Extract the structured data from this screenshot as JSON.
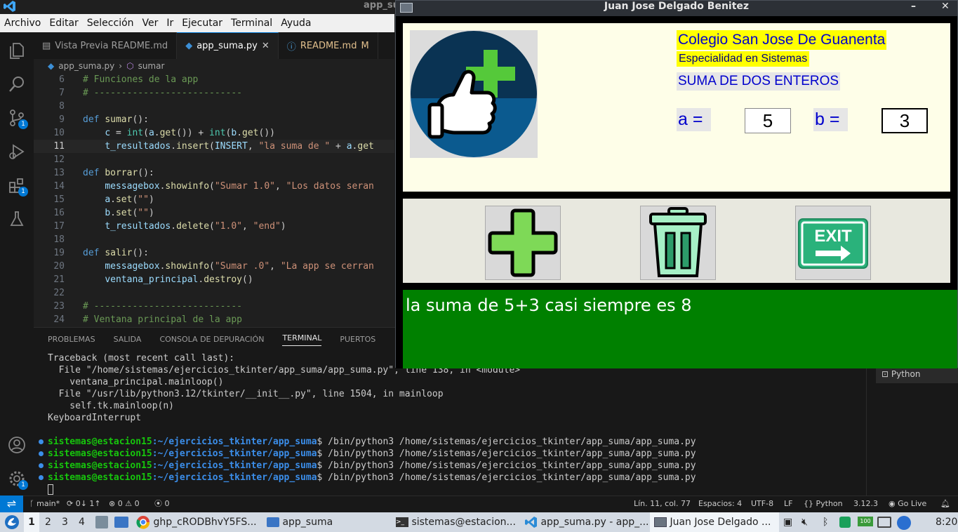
{
  "vscode": {
    "window_title": "app_su",
    "menu": [
      "Archivo",
      "Editar",
      "Selección",
      "Ver",
      "Ir",
      "Ejecutar",
      "Terminal",
      "Ayuda"
    ],
    "tabs": [
      {
        "label": "Vista Previa README.md",
        "active": false
      },
      {
        "label": "app_suma.py",
        "active": true
      },
      {
        "label": "README.md",
        "modified": "M",
        "active": false
      }
    ],
    "breadcrumb": {
      "file": "app_suma.py",
      "symbol": "sumar"
    },
    "badges": {
      "scm": "1",
      "extensions": "1",
      "settings": "1"
    },
    "code": [
      {
        "n": "6",
        "html": "<span class='cm'># Funciones de la app</span>"
      },
      {
        "n": "7",
        "html": "<span class='cm'># ---------------------------</span>"
      },
      {
        "n": "8",
        "html": ""
      },
      {
        "n": "9",
        "html": "<span class='kw'>def</span> <span class='fn'>sumar</span>():"
      },
      {
        "n": "10",
        "html": "    <span class='va'>c</span> = <span class='bi'>int</span>(<span class='va'>a</span>.<span class='fn'>get</span>()) + <span class='bi'>int</span>(<span class='va'>b</span>.<span class='fn'>get</span>())"
      },
      {
        "n": "11",
        "html": "    <span class='va'>t_resultados</span>.<span class='fn'>insert</span>(<span class='va'>INSERT</span>, <span class='st'>\"la suma de \"</span> + <span class='va'>a</span>.<span class='fn'>get</span>",
        "current": true
      },
      {
        "n": "12",
        "html": ""
      },
      {
        "n": "13",
        "html": "<span class='kw'>def</span> <span class='fn'>borrar</span>():"
      },
      {
        "n": "14",
        "html": "    <span class='va'>messagebox</span>.<span class='fn'>showinfo</span>(<span class='st'>\"Sumar 1.0\"</span>, <span class='st'>\"Los datos seran</span>"
      },
      {
        "n": "15",
        "html": "    <span class='va'>a</span>.<span class='fn'>set</span>(<span class='st'>\"\"</span>)"
      },
      {
        "n": "16",
        "html": "    <span class='va'>b</span>.<span class='fn'>set</span>(<span class='st'>\"\"</span>)"
      },
      {
        "n": "17",
        "html": "    <span class='va'>t_resultados</span>.<span class='fn'>delete</span>(<span class='st'>\"1.0\"</span>, <span class='st'>\"end\"</span>)"
      },
      {
        "n": "18",
        "html": ""
      },
      {
        "n": "19",
        "html": "<span class='kw'>def</span> <span class='fn'>salir</span>():"
      },
      {
        "n": "20",
        "html": "    <span class='va'>messagebox</span>.<span class='fn'>showinfo</span>(<span class='st'>\"Sumar .0\"</span>, <span class='st'>\"La app se cerran</span>"
      },
      {
        "n": "21",
        "html": "    <span class='va'>ventana_principal</span>.<span class='fn'>destroy</span>()"
      },
      {
        "n": "22",
        "html": ""
      },
      {
        "n": "23",
        "html": "<span class='cm'># ---------------------------</span>"
      },
      {
        "n": "24",
        "html": "<span class='cm'># Ventana principal de la app</span>"
      }
    ],
    "panel_tabs": [
      "PROBLEMAS",
      "SALIDA",
      "CONSOLA DE DEPURACIÓN",
      "TERMINAL",
      "PUERTOS"
    ],
    "active_panel_tab": "TERMINAL",
    "terminal": {
      "traceback": [
        "Traceback (most recent call last):",
        "  File \"/home/sistemas/ejercicios_tkinter/app_suma/app_suma.py\", line 138, in <module>",
        "    ventana_principal.mainloop()",
        "  File \"/usr/lib/python3.12/tkinter/__init__.py\", line 1504, in mainloop",
        "    self.tk.mainloop(n)",
        "KeyboardInterrupt"
      ],
      "prompt_user": "sistemas@estacion15",
      "prompt_path": ":~/ejercicios_tkinter/app_suma",
      "command": "$ /bin/python3 /home/sistemas/ejercicios_tkinter/app_suma/app_suma.py",
      "command_count": 4,
      "shell_label": "Python"
    },
    "status": {
      "branch": "main*",
      "sync": "0↓ 1↑",
      "problems": "0",
      "warnings": "0",
      "ports": "0",
      "position": "Lín. 11, col. 77",
      "spaces": "Espacios: 4",
      "encoding": "UTF-8",
      "eol": "LF",
      "language": "Python",
      "python_version": "3.12.3",
      "golive": "Go Live"
    }
  },
  "tk": {
    "title": "Juan Jose Delgado Benitez",
    "school": "Colegio San Jose De Guanenta",
    "specialty": "Especialidad en Sistemas",
    "heading": "SUMA DE DOS ENTEROS",
    "label_a": "a =",
    "label_b": "b =",
    "value_a": "5",
    "value_b": "3",
    "exit_text": "EXIT",
    "result": "la suma de 5+3 casi siempre es 8"
  },
  "taskbar": {
    "workspaces": [
      "1",
      "2",
      "3",
      "4"
    ],
    "items": [
      {
        "label": "ghp_cRODBhvY5FS..."
      },
      {
        "label": "app_suma"
      },
      {
        "label": "sistemas@estacion..."
      },
      {
        "label": "app_suma.py - app_..."
      },
      {
        "label": "Juan Jose Delgado ..."
      }
    ],
    "battery": "100",
    "clock": "8:20"
  }
}
